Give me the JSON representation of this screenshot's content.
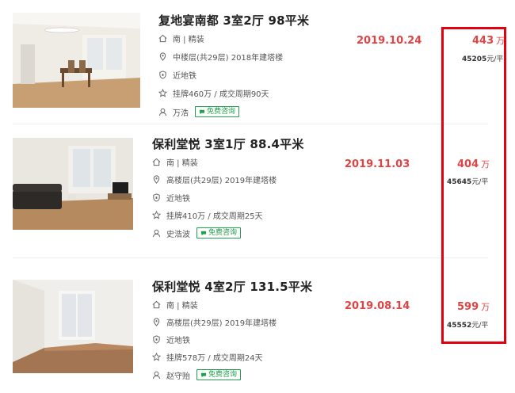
{
  "listings": [
    {
      "title": "复地宴南都 3室2厅 98平米",
      "orientation": "南 | 精装",
      "floor": "中楼层(共29层) 2018年建塔楼",
      "tag": "近地铁",
      "listing_info": "挂牌460万 / 成交周期90天",
      "agent": "万浩",
      "consult_label": "免费咨询",
      "date": "2019.10.24",
      "price": "443",
      "price_unit": "万",
      "unit_price": "45205",
      "unit_price_suffix": "元/平"
    },
    {
      "title": "保利堂悦 3室1厅 88.4平米",
      "orientation": "南 | 精装",
      "floor": "高楼层(共29层) 2019年建塔楼",
      "tag": "近地铁",
      "listing_info": "挂牌410万 / 成交周期25天",
      "agent": "史浩波",
      "consult_label": "免费咨询",
      "date": "2019.11.03",
      "price": "404",
      "price_unit": "万",
      "unit_price": "45645",
      "unit_price_suffix": "元/平"
    },
    {
      "title": "保利堂悦 4室2厅 131.5平米",
      "orientation": "南 | 精装",
      "floor": "高楼层(共29层) 2019年建塔楼",
      "tag": "近地铁",
      "listing_info": "挂牌578万 / 成交周期24天",
      "agent": "赵守贻",
      "consult_label": "免费咨询",
      "date": "2019.08.14",
      "price": "599",
      "price_unit": "万",
      "unit_price": "45552",
      "unit_price_suffix": "元/平"
    }
  ],
  "colors": {
    "accent_red": "#e04343",
    "highlight_border": "#e3000f",
    "consult_green": "#21a04e"
  },
  "icons": [
    "house-icon",
    "location-pin-icon",
    "shield-icon",
    "star-icon",
    "person-icon",
    "chat-bubble-icon"
  ]
}
